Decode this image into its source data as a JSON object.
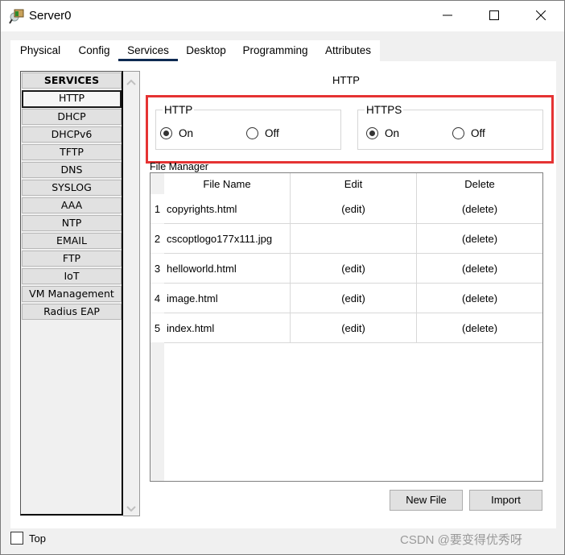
{
  "window": {
    "title": "Server0",
    "icon": "server-icon",
    "controls": {
      "minimize": "minimize-icon",
      "maximize": "maximize-icon",
      "close": "close-icon"
    }
  },
  "tabs": [
    {
      "label": "Physical",
      "active": false
    },
    {
      "label": "Config",
      "active": false
    },
    {
      "label": "Services",
      "active": true
    },
    {
      "label": "Desktop",
      "active": false
    },
    {
      "label": "Programming",
      "active": false
    },
    {
      "label": "Attributes",
      "active": false
    }
  ],
  "services": {
    "header": "SERVICES",
    "items": [
      "HTTP",
      "DHCP",
      "DHCPv6",
      "TFTP",
      "DNS",
      "SYSLOG",
      "AAA",
      "NTP",
      "EMAIL",
      "FTP",
      "IoT",
      "VM Management",
      "Radius EAP"
    ],
    "selected": "HTTP"
  },
  "http_panel": {
    "title": "HTTP",
    "http_group": {
      "label": "HTTP",
      "on_label": "On",
      "off_label": "Off",
      "value": "On"
    },
    "https_group": {
      "label": "HTTPS",
      "on_label": "On",
      "off_label": "Off",
      "value": "On"
    },
    "highlight_color": "#e53333"
  },
  "file_manager": {
    "label": "File Manager",
    "columns": [
      "File Name",
      "Edit",
      "Delete"
    ],
    "rows": [
      {
        "num": "1",
        "name": "copyrights.html",
        "edit": "(edit)",
        "delete": "(delete)"
      },
      {
        "num": "2",
        "name": "cscoptlogo177x111.jpg",
        "edit": "",
        "delete": "(delete)"
      },
      {
        "num": "3",
        "name": "helloworld.html",
        "edit": "(edit)",
        "delete": "(delete)"
      },
      {
        "num": "4",
        "name": "image.html",
        "edit": "(edit)",
        "delete": "(delete)"
      },
      {
        "num": "5",
        "name": "index.html",
        "edit": "(edit)",
        "delete": "(delete)"
      }
    ],
    "new_file_label": "New File",
    "import_label": "Import"
  },
  "footer": {
    "top_label": "Top",
    "top_checked": false,
    "watermark": "CSDN @要变得优秀呀"
  }
}
